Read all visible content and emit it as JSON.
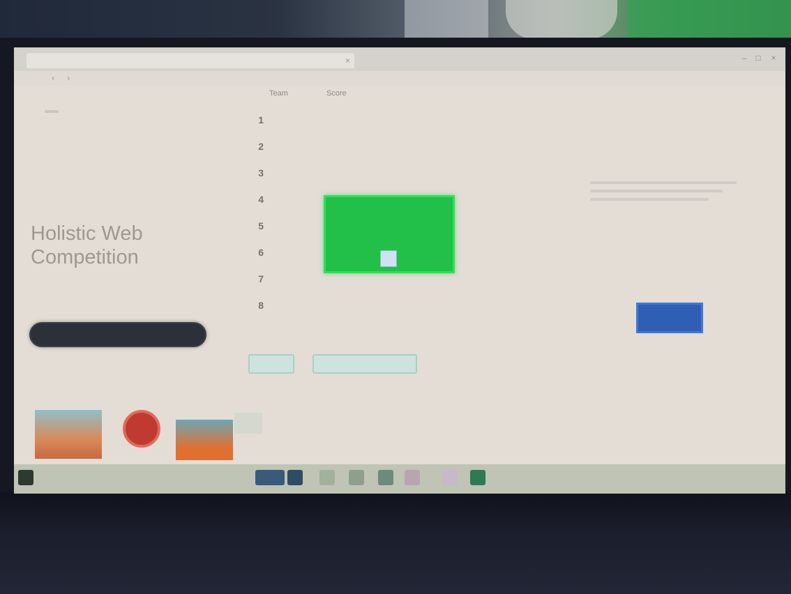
{
  "browser": {
    "tab_title": "",
    "tab_close": "×",
    "controls": [
      "–",
      "□",
      "×"
    ]
  },
  "nav": {
    "back": "‹",
    "forward": "›"
  },
  "left": {
    "logo_text": "",
    "logo_badge": "",
    "headline": "Holistic Web Competition",
    "subline": "",
    "primary_button": ""
  },
  "list": {
    "header": [
      "",
      "Team",
      "Score"
    ],
    "rows": [
      {
        "num": "1",
        "name": "",
        "val": "",
        "tag": ""
      },
      {
        "num": "2",
        "name": "",
        "val": "",
        "tag": ""
      },
      {
        "num": "3",
        "name": "",
        "val": "",
        "tag": ""
      },
      {
        "num": "4",
        "name": "",
        "val": "",
        "tag": ""
      },
      {
        "num": "5",
        "name": "",
        "val": "",
        "tag": ""
      },
      {
        "num": "6",
        "name": "",
        "val": "",
        "tag": ""
      },
      {
        "num": "7",
        "name": "",
        "val": "",
        "tag": ""
      },
      {
        "num": "8",
        "name": "",
        "val": "",
        "tag": ""
      }
    ]
  },
  "popup": {
    "title": "",
    "text": "",
    "ok": ""
  },
  "actions": {
    "left_button": "",
    "right_button": ""
  },
  "right": {
    "small": "",
    "title": "",
    "button": ""
  },
  "taskbar": {
    "tray": ""
  },
  "colors": {
    "popup_green": "#22c048",
    "primary_dark": "#2c3038",
    "accent_blue": "#2f5fb4",
    "taskbar": "#bfc4b4"
  },
  "icons": [
    "close-icon",
    "back-arrow-icon",
    "forward-arrow-icon",
    "windows-start-icon",
    "browser-icon",
    "folder-icon",
    "media-icon"
  ]
}
